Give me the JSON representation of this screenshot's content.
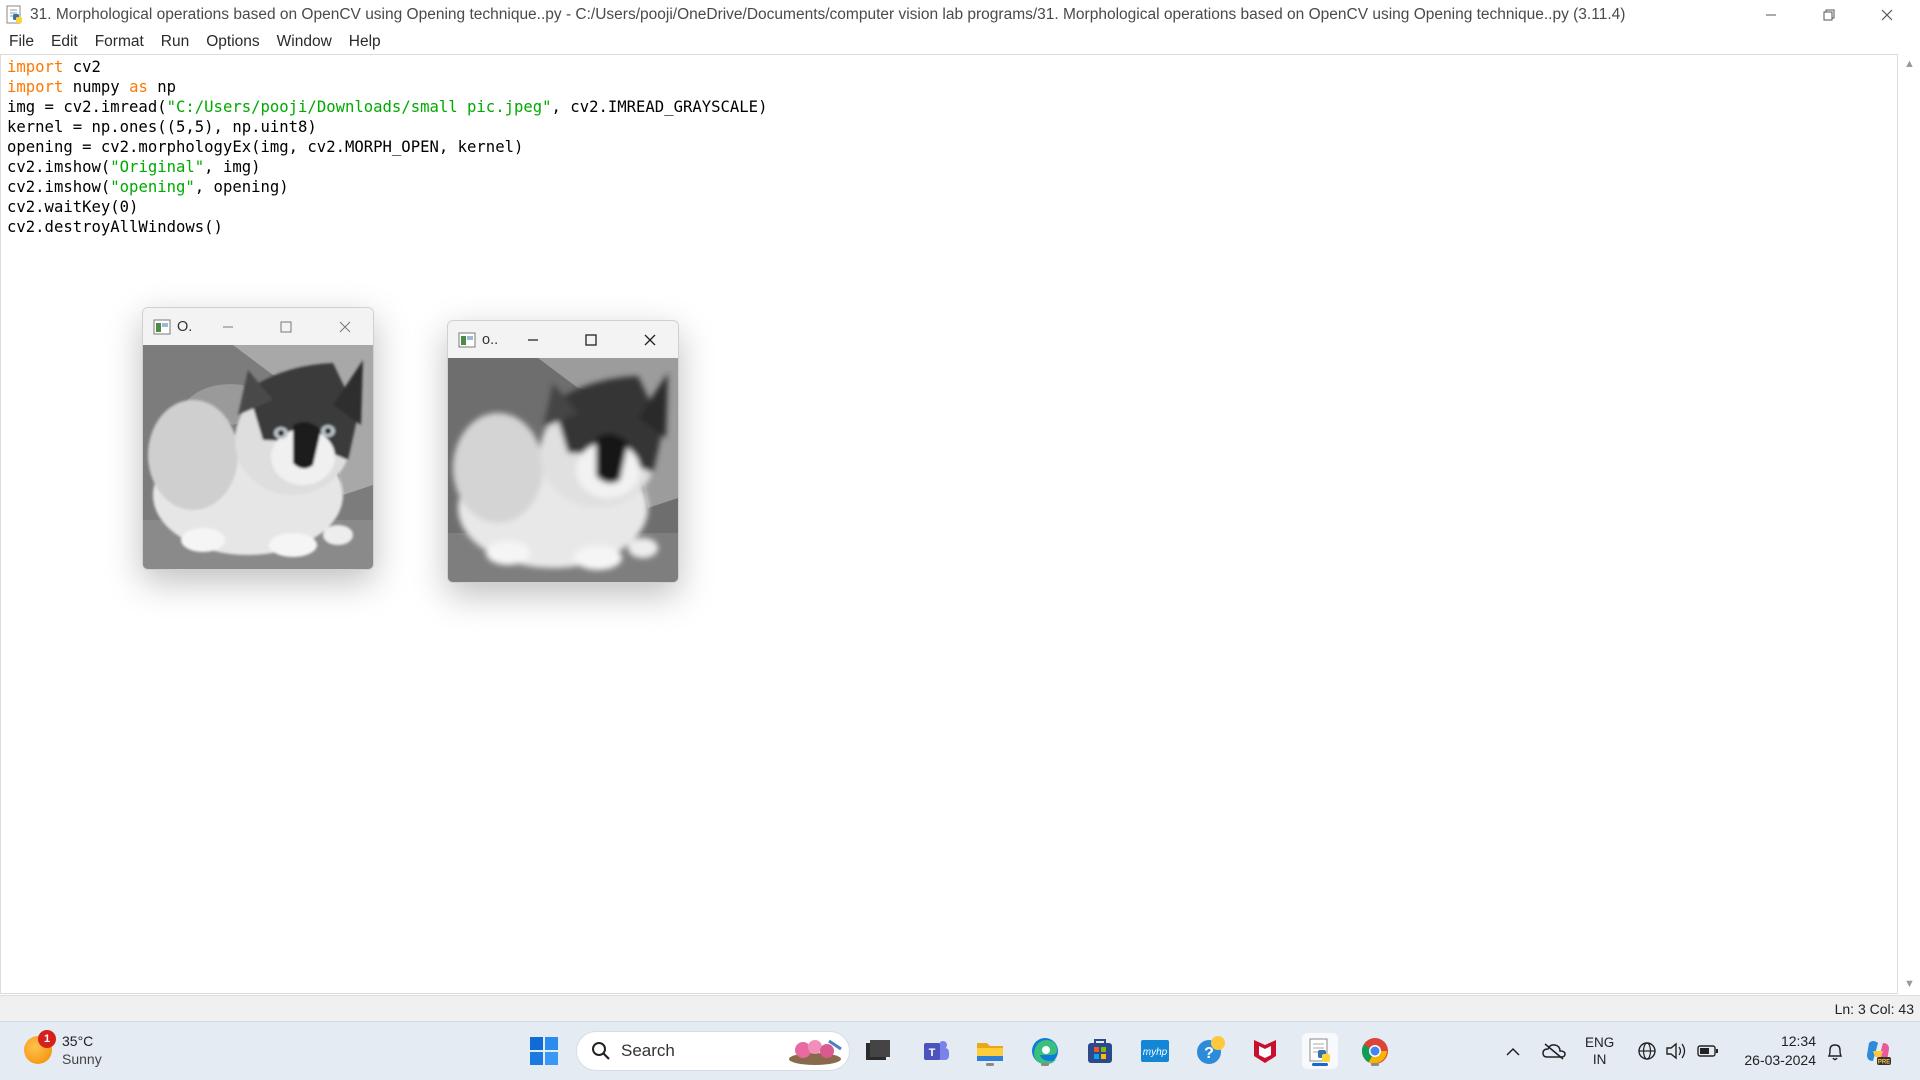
{
  "window": {
    "title": "31. Morphological operations based on OpenCV using Opening technique..py - C:/Users/pooji/OneDrive/Documents/computer vision lab programs/31. Morphological operations based on OpenCV using Opening technique..py (3.11.4)"
  },
  "menu": [
    "File",
    "Edit",
    "Format",
    "Run",
    "Options",
    "Window",
    "Help"
  ],
  "code": {
    "line1_kw": "import",
    "line1_rest": " cv2",
    "line2_kw": "import",
    "line2_mid": " numpy ",
    "line2_kw2": "as",
    "line2_rest": " np",
    "line3_pre": "img = cv2.imread(",
    "line3_str": "\"C:/Users/pooji/Downloads/small pic.jpeg\"",
    "line3_post": ", cv2.IMREAD_GRAYSCALE)",
    "line4": "kernel = np.ones((5,5), np.uint8)",
    "line5": "opening = cv2.morphologyEx(img, cv2.MORPH_OPEN, kernel)",
    "line6_pre": "cv2.imshow(",
    "line6_str": "\"Original\"",
    "line6_post": ", img)",
    "line7_pre": "cv2.imshow(",
    "line7_str": "\"opening\"",
    "line7_post": ", opening)",
    "line8": "cv2.waitKey(0)",
    "line9": "cv2.destroyAllWindows()"
  },
  "cv_windows": [
    {
      "title": "O."
    },
    {
      "title": "o.."
    }
  ],
  "status": {
    "position": "Ln: 3   Col: 43"
  },
  "taskbar": {
    "weather": {
      "temp": "35°C",
      "condition": "Sunny",
      "alerts": "1"
    },
    "search_label": "Search",
    "apps": [
      "file-explorer-folder-icon",
      "edge-icon",
      "store-icon",
      "myhp-icon",
      "help-icon",
      "mcafee-icon",
      "python-idle-icon",
      "chrome-icon",
      "teams-icon",
      "terminal-icon"
    ],
    "language": {
      "line1": "ENG",
      "line2": "IN"
    },
    "clock": {
      "time": "12:34",
      "date": "26-03-2024"
    }
  },
  "colors": {
    "keyword": "#ff7700",
    "string": "#00aa00",
    "taskbar_bg": "#e4ebf3",
    "accent": "#1a68c9"
  }
}
